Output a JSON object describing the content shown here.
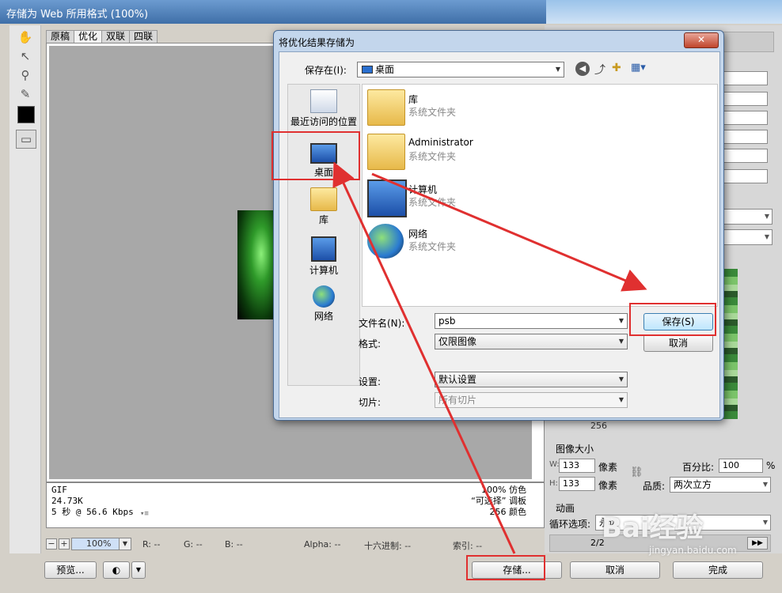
{
  "window": {
    "title": "存储为 Web 所用格式 (100%)"
  },
  "tabs": [
    "原稿",
    "优化",
    "双联",
    "四联"
  ],
  "info": {
    "format": "GIF",
    "size": "24.73K",
    "speed": "5 秒 @ 56.6 Kbps",
    "dither": "100% 仿色",
    "palette": "“可选择” 调板",
    "colors": "256 颜色"
  },
  "statusbar": {
    "zoom": "100%",
    "r": "R: --",
    "g": "G: --",
    "b": "B: --",
    "alpha": "Alpha: --",
    "hex": "十六进制: --",
    "index": "索引: --"
  },
  "buttons": {
    "preview": "预览...",
    "save": "存储...",
    "cancel": "取消",
    "done": "完成"
  },
  "right_panel": {
    "image_size_title": "图像大小",
    "w_label": "W:",
    "w_value": "133",
    "w_unit": "像素",
    "h_label": "H:",
    "h_value": "133",
    "h_unit": "像素",
    "percent_label": "百分比:",
    "percent_value": "100",
    "percent_unit": "%",
    "quality_label": "品质:",
    "quality_value": "两次立方",
    "animation_title": "动画",
    "loop_label": "循环选项:",
    "loop_value": "永远",
    "frame": "2/2",
    "color_count": "256"
  },
  "dialog": {
    "title": "将优化结果存储为",
    "close": "✕",
    "save_in_label": "保存在(I):",
    "save_in_value": "桌面",
    "places": [
      "最近访问的位置",
      "桌面",
      "库",
      "计算机",
      "网络"
    ],
    "files": [
      {
        "name": "库",
        "sub": "系统文件夹"
      },
      {
        "name": "Administrator",
        "sub": "系统文件夹"
      },
      {
        "name": "计算机",
        "sub": "系统文件夹"
      },
      {
        "name": "网络",
        "sub": "系统文件夹"
      }
    ],
    "filename_label": "文件名(N):",
    "filename_value": "psb",
    "format_label": "格式:",
    "format_value": "仅限图像",
    "settings_label": "设置:",
    "settings_value": "默认设置",
    "slices_label": "切片:",
    "slices_value": "所有切片",
    "save_button": "保存(S)",
    "cancel_button": "取消"
  },
  "watermark": "Bai经验",
  "watermark_sub": "jingyan.baidu.com",
  "colors": {
    "highlight": "#e03030",
    "dialog_frame": "#c3d6ec",
    "titlebar": "#3f6fa8"
  }
}
